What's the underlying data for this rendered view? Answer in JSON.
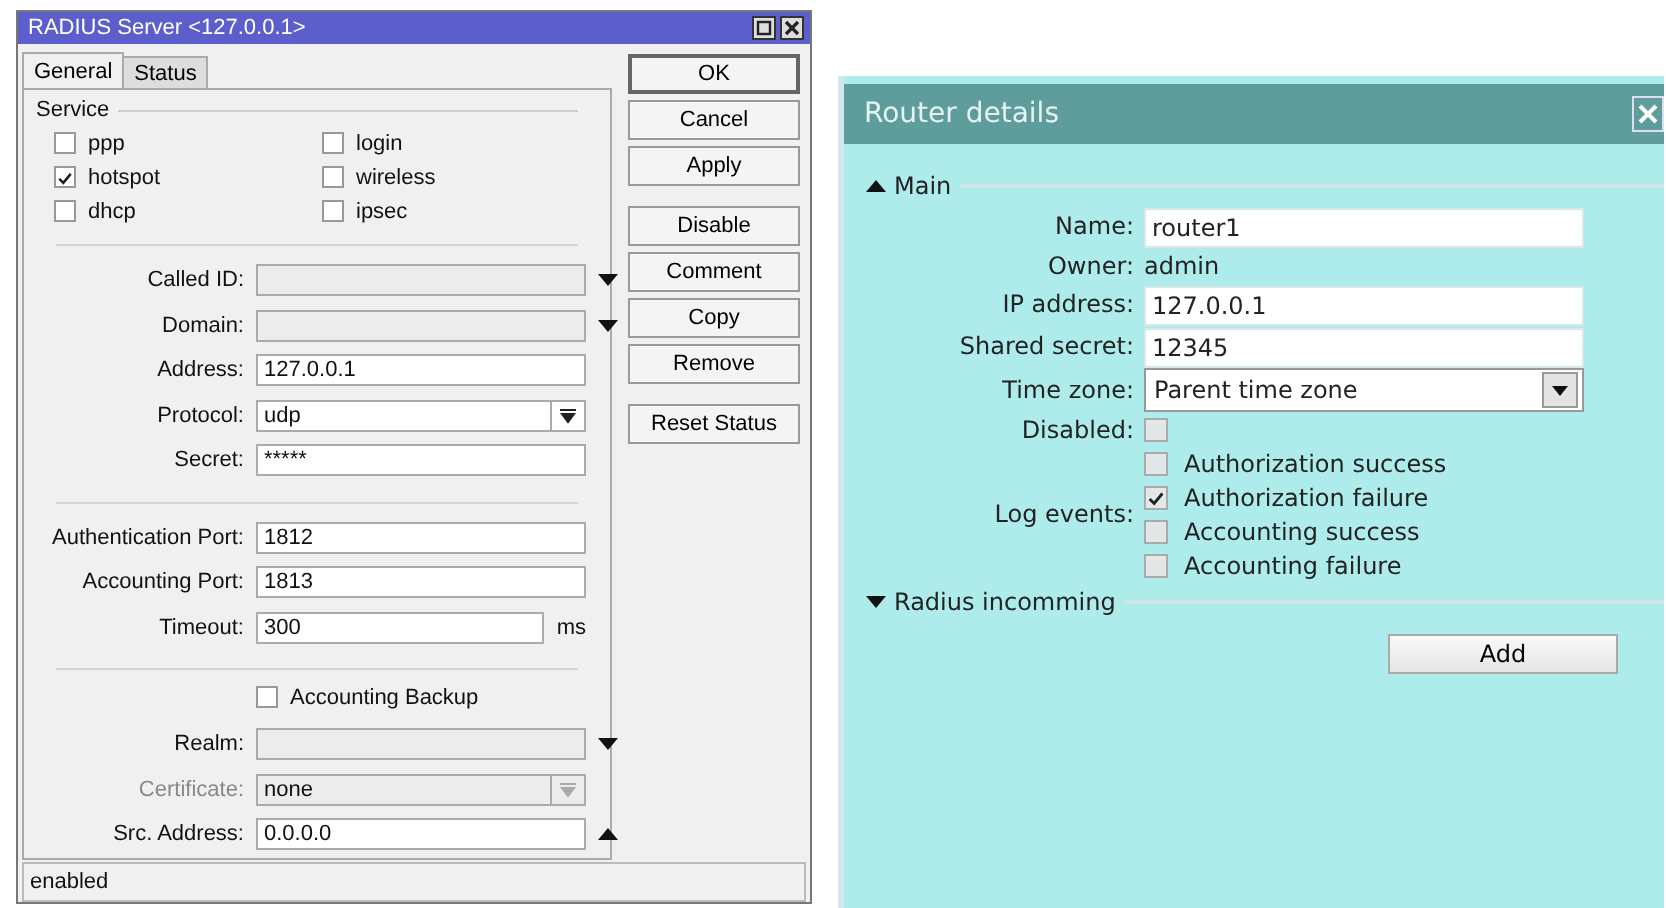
{
  "radius_window": {
    "title": "RADIUS Server <127.0.0.1>",
    "tabs": [
      {
        "label": "General",
        "selected": true
      },
      {
        "label": "Status",
        "selected": false
      }
    ],
    "service": {
      "label": "Service",
      "options": [
        {
          "label": "ppp",
          "checked": false
        },
        {
          "label": "login",
          "checked": false
        },
        {
          "label": "hotspot",
          "checked": true
        },
        {
          "label": "wireless",
          "checked": false
        },
        {
          "label": "dhcp",
          "checked": false
        },
        {
          "label": "ipsec",
          "checked": false
        }
      ]
    },
    "sections": [
      [
        {
          "kind": "dropdown",
          "label": "Called ID:"
        },
        {
          "kind": "dropdown",
          "label": "Domain:"
        },
        {
          "kind": "text",
          "label": "Address:",
          "value": "127.0.0.1"
        },
        {
          "kind": "select",
          "label": "Protocol:",
          "value": "udp"
        },
        {
          "kind": "text",
          "label": "Secret:",
          "value": "*****"
        }
      ],
      [
        {
          "kind": "text",
          "label": "Authentication Port:",
          "value": "1812"
        },
        {
          "kind": "text",
          "label": "Accounting Port:",
          "value": "1813"
        },
        {
          "kind": "unit",
          "label": "Timeout:",
          "value": "300",
          "unit": "ms"
        }
      ],
      [
        {
          "kind": "checkbox",
          "label": "Accounting Backup",
          "checked": false
        },
        {
          "kind": "dropdown",
          "label": "Realm:"
        },
        {
          "kind": "select",
          "label": "Certificate:",
          "value": "none",
          "disabled": true
        },
        {
          "kind": "collapse",
          "label": "Src. Address:",
          "value": "0.0.0.0"
        }
      ]
    ],
    "buttons": [
      "OK",
      "Cancel",
      "Apply",
      "Disable",
      "Comment",
      "Copy",
      "Remove",
      "Reset Status"
    ],
    "status_bar": "enabled"
  },
  "router_details": {
    "title": "Router details",
    "sections": [
      {
        "label": "Main",
        "expanded": true,
        "rows": [
          {
            "kind": "text",
            "label": "Name:",
            "value": "router1"
          },
          {
            "kind": "static",
            "label": "Owner:",
            "value": "admin"
          },
          {
            "kind": "text",
            "label": "IP address:",
            "value": "127.0.0.1"
          },
          {
            "kind": "text",
            "label": "Shared secret:",
            "value": "12345"
          },
          {
            "kind": "select",
            "label": "Time zone:",
            "value": "Parent time zone"
          },
          {
            "kind": "checkbox",
            "label": "Disabled:",
            "checked": false
          },
          {
            "kind": "checklist",
            "label": "Log events:",
            "options": [
              {
                "label": "Authorization success",
                "checked": false
              },
              {
                "label": "Authorization failure",
                "checked": true
              },
              {
                "label": "Accounting success",
                "checked": false
              },
              {
                "label": "Accounting failure",
                "checked": false
              }
            ]
          }
        ]
      },
      {
        "label": "Radius incomming",
        "expanded": false
      }
    ],
    "add_button": "Add"
  }
}
